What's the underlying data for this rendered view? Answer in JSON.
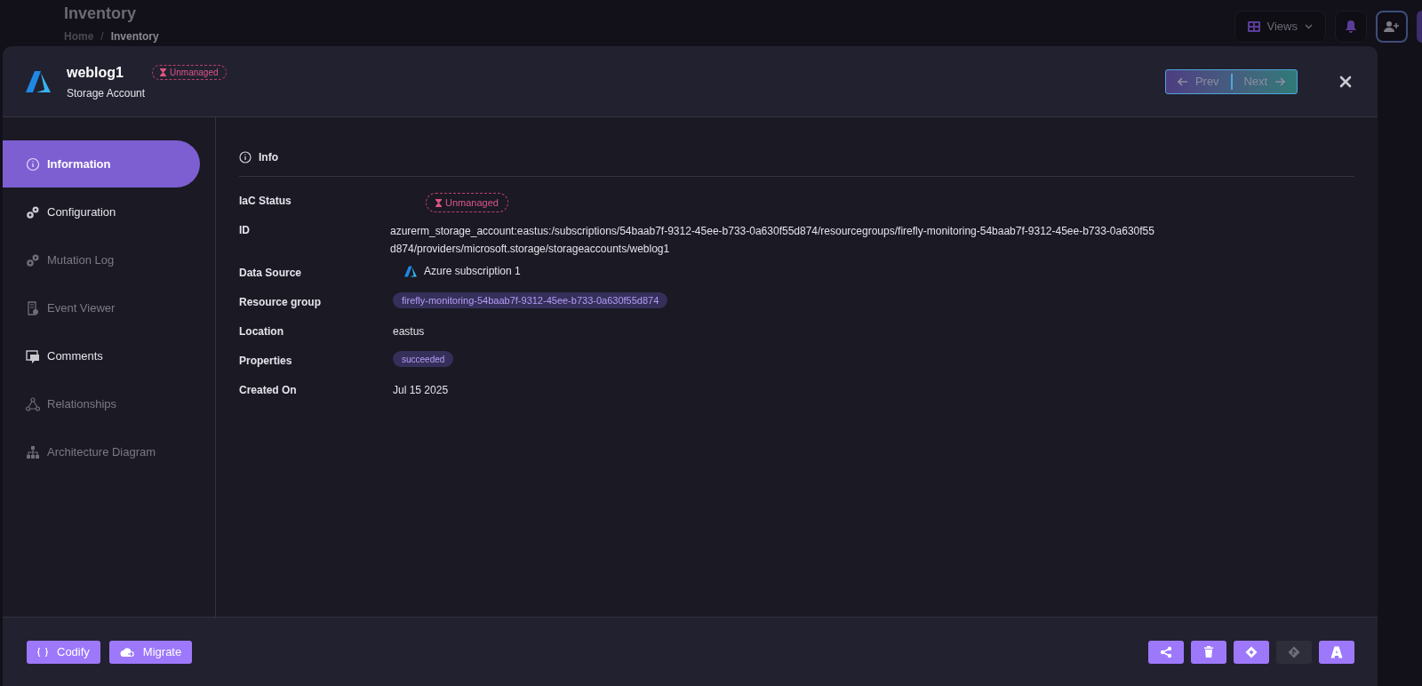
{
  "page": {
    "title": "Inventory",
    "breadcrumb_separator": "/",
    "breadcrumb": [
      {
        "label": "Home",
        "current": false
      },
      {
        "label": "Inventory",
        "current": true
      }
    ],
    "views_button": "Views"
  },
  "modal": {
    "title": "weblog1",
    "subtitle": "Storage Account",
    "status_badge": "Unmanaged",
    "prev": "Prev",
    "next": "Next",
    "nav": [
      {
        "label": "Information",
        "selected": true,
        "disabled": false
      },
      {
        "label": "Configuration",
        "selected": false,
        "disabled": false
      },
      {
        "label": "Mutation Log",
        "selected": false,
        "disabled": true
      },
      {
        "label": "Event Viewer",
        "selected": false,
        "disabled": true
      },
      {
        "label": "Comments",
        "selected": false,
        "disabled": false
      },
      {
        "label": "Relationships",
        "selected": false,
        "disabled": true
      },
      {
        "label": "Architecture Diagram",
        "selected": false,
        "disabled": true
      }
    ],
    "section_title": "Info",
    "fields": [
      {
        "label": "IaC Status",
        "kind": "status",
        "value": "Unmanaged"
      },
      {
        "label": "ID",
        "kind": "text",
        "value": "azurerm_storage_account:eastus:/subscriptions/54baab7f-9312-45ee-b733-0a630f55d874/resourcegroups/firefly-monitoring-54baab7f-9312-45ee-b733-0a630f55d874/providers/microsoft.storage/storageaccounts/weblog1"
      },
      {
        "label": "Data Source",
        "kind": "source",
        "value": "Azure subscription 1"
      },
      {
        "label": "Resource group",
        "kind": "pill",
        "value": "firefly-monitoring-54baab7f-9312-45ee-b733-0a630f55d874"
      },
      {
        "label": "Location",
        "kind": "text",
        "value": "eastus"
      },
      {
        "label": "Properties",
        "kind": "pill",
        "value": "succeeded"
      },
      {
        "label": "Created On",
        "kind": "text",
        "value": "Jul 15 2025"
      }
    ],
    "footer_buttons": [
      "Codify",
      "Migrate"
    ],
    "footer_icons": [
      {
        "disabled": false
      },
      {
        "disabled": false
      },
      {
        "disabled": false
      },
      {
        "disabled": true
      },
      {
        "disabled": false
      }
    ]
  }
}
